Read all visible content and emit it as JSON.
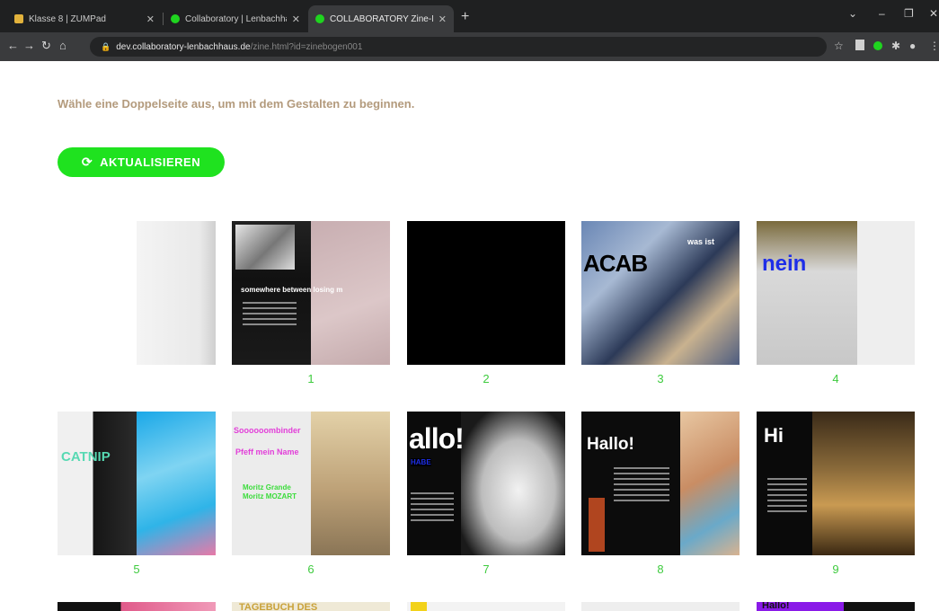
{
  "browser": {
    "tabs": [
      {
        "label": "Klasse 8 | ZUMPad",
        "color": "#e2b23c",
        "active": false
      },
      {
        "label": "Collaboratory | Lenbachhaus Co",
        "color": "#1fd41f",
        "active": false
      },
      {
        "label": "COLLABORATORY Zine-Modul",
        "color": "#1fd41f",
        "active": true
      }
    ],
    "url_host": "dev.collaboratory-lenbachhaus.de",
    "url_path": "/zine.html?id=zinebogen001"
  },
  "page": {
    "instruction": "Wähle eine Doppelseite aus, um mit dem Gestalten zu beginnen.",
    "refresh_button": "AKTUALISIEREN",
    "spreads": [
      {
        "number": "",
        "texts": []
      },
      {
        "number": "1",
        "texts": [
          "somewhere between losing m"
        ]
      },
      {
        "number": "2",
        "texts": []
      },
      {
        "number": "3",
        "texts": [
          "ACAB",
          "was ist"
        ]
      },
      {
        "number": "4",
        "texts": [
          "nein"
        ]
      },
      {
        "number": "5",
        "texts": [
          "CATNIP"
        ]
      },
      {
        "number": "6",
        "texts": [
          "Soooooombinder",
          "Pfeff mein Name",
          "Moritz Grande Moritz MOZART"
        ]
      },
      {
        "number": "7",
        "texts": [
          "allo!",
          "HABE"
        ]
      },
      {
        "number": "8",
        "texts": [
          "Hallo!"
        ]
      },
      {
        "number": "9",
        "texts": [
          "Hi"
        ]
      },
      {
        "number": "",
        "texts": []
      },
      {
        "number": "",
        "texts": [
          "TAGEBUCH DES"
        ]
      },
      {
        "number": "",
        "texts": []
      },
      {
        "number": "",
        "texts": []
      },
      {
        "number": "",
        "texts": [
          "Hallo!"
        ]
      }
    ]
  }
}
